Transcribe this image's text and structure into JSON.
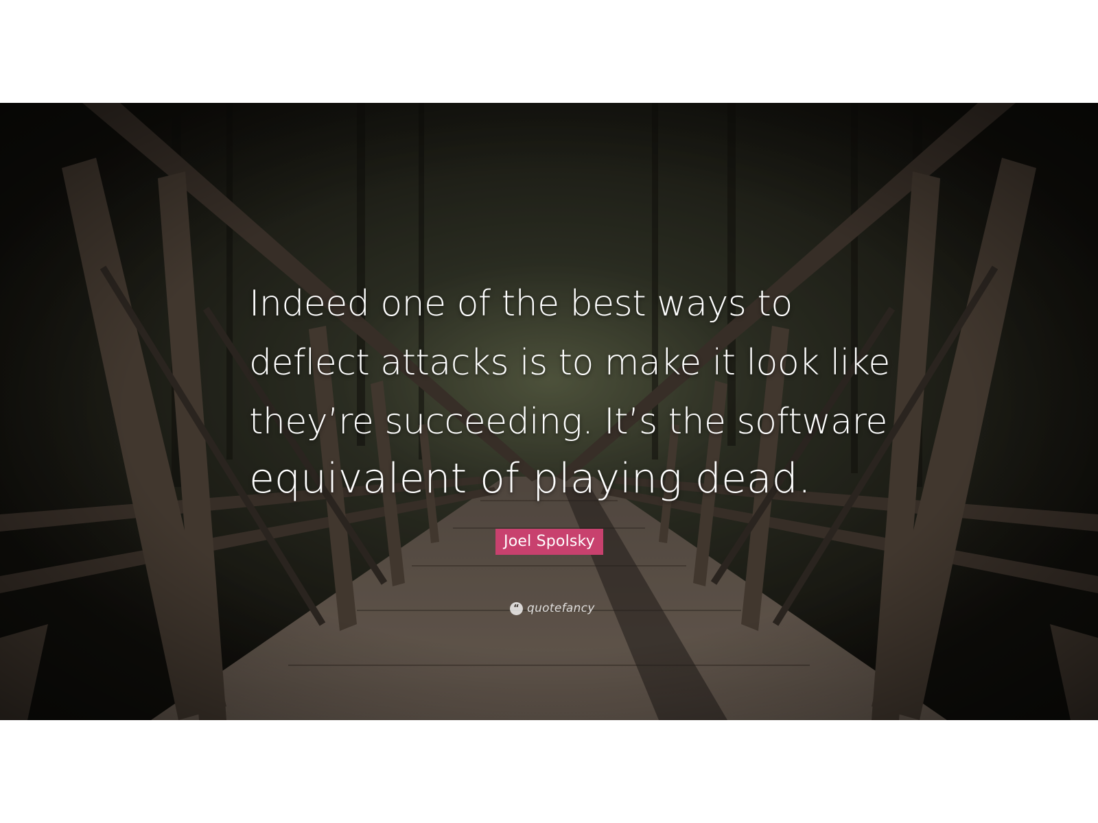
{
  "quote": {
    "lines": [
      "Indeed one of the best ways to",
      "deflect attacks is to make it look like",
      "they’re succeeding. It’s the software",
      "equivalent of playing dead."
    ]
  },
  "author": "Joel Spolsky",
  "brand": {
    "name": "quotefancy",
    "icon": "quote-marks-icon",
    "icon_glyph": "“"
  },
  "background": {
    "subject": "wooden footbridge through a forest",
    "colors": {
      "forest": "#1e211a",
      "wood": "#5a4c40",
      "deck": "#7a6b5e",
      "author_badge": "#c8416e"
    }
  }
}
